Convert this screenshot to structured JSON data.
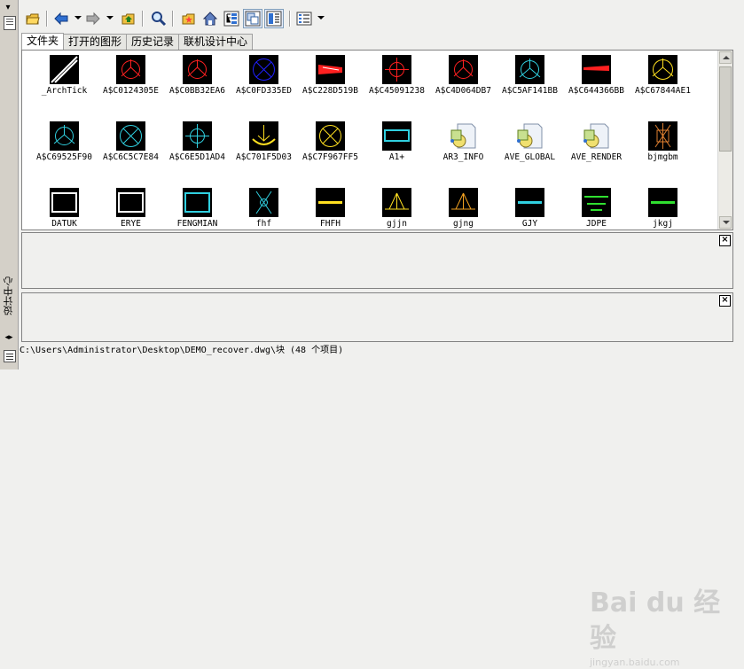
{
  "side_panel": {
    "title": "设计中心",
    "arrows_glyph": "◂▸"
  },
  "toolbar": {
    "buttons": [
      {
        "name": "load-icon"
      },
      {
        "name": "back-icon"
      },
      {
        "name": "forward-icon"
      },
      {
        "name": "up-icon"
      },
      {
        "name": "search-icon"
      },
      {
        "name": "favorites-icon"
      },
      {
        "name": "home-icon"
      },
      {
        "name": "tree-toggle-icon"
      },
      {
        "name": "preview-icon"
      },
      {
        "name": "description-icon"
      },
      {
        "name": "views-icon"
      }
    ]
  },
  "tabs": [
    {
      "label": "文件夹",
      "active": true
    },
    {
      "label": "打开的图形",
      "active": false
    },
    {
      "label": "历史记录",
      "active": false
    },
    {
      "label": "联机设计中心",
      "active": false
    }
  ],
  "colors": {
    "black": "#000000",
    "red": "#ff2020",
    "blue": "#2020ff",
    "cyan": "#30d0e0",
    "yellow": "#ffe020",
    "white": "#ffffff"
  },
  "items": [
    {
      "label": "_ArchTick",
      "icon": "archtick-icon"
    },
    {
      "label": "A$C0124305E",
      "icon": "red-circle-icon"
    },
    {
      "label": "A$C0BB32EA6",
      "icon": "red-circle-icon"
    },
    {
      "label": "A$C0FD335ED",
      "icon": "blue-x-circle-icon"
    },
    {
      "label": "A$C228D519B",
      "icon": "red-wedge-icon"
    },
    {
      "label": "A$C45091238",
      "icon": "red-cross-icon"
    },
    {
      "label": "A$C4D064DB7",
      "icon": "red-circle-icon"
    },
    {
      "label": "A$C5AF141BB",
      "icon": "cyan-circle-icon"
    },
    {
      "label": "A$C644366BB",
      "icon": "red-bar-icon"
    },
    {
      "label": "A$C67844AE1",
      "icon": "yellow-circle-icon"
    },
    {
      "label": "A$C69525F90",
      "icon": "cyan-circle-icon"
    },
    {
      "label": "A$C6C5C7E84",
      "icon": "cyan-x-circle-icon"
    },
    {
      "label": "A$C6E5D1AD4",
      "icon": "cyan-cross-icon"
    },
    {
      "label": "A$C701F5D03",
      "icon": "yellow-arc-icon"
    },
    {
      "label": "A$C7F967FF5",
      "icon": "yellow-x-circle-icon"
    },
    {
      "label": "A1+",
      "icon": "cyan-rect-icon"
    },
    {
      "label": "AR3_INFO",
      "icon": "dwg-file-icon"
    },
    {
      "label": "AVE_GLOBAL",
      "icon": "dwg-file-icon"
    },
    {
      "label": "AVE_RENDER",
      "icon": "dwg-file-icon"
    },
    {
      "label": "bjmgbm",
      "icon": "orange-arrows-icon"
    },
    {
      "label": "DATUK",
      "icon": "white-frame-icon"
    },
    {
      "label": "ERYE",
      "icon": "white-frame-icon"
    },
    {
      "label": "FENGMIAN",
      "icon": "cyan-frame-icon"
    },
    {
      "label": "fhf",
      "icon": "cyan-arrows-icon"
    },
    {
      "label": "FHFH",
      "icon": "yellow-line-icon"
    },
    {
      "label": "gjjn",
      "icon": "yellow-triangle-icon"
    },
    {
      "label": "gjng",
      "icon": "orange-triangle-icon"
    },
    {
      "label": "GJY",
      "icon": "cyan-line-icon"
    },
    {
      "label": "JDPE",
      "icon": "green-lines-icon"
    },
    {
      "label": "jkgj",
      "icon": "green-line-icon"
    }
  ],
  "status": {
    "path": "C:\\Users\\Administrator\\Desktop\\DEMO_recover.dwg\\块 (48 个项目)"
  },
  "watermark": {
    "brand": "Bai du 经验",
    "url": "jingyan.baidu.com"
  }
}
